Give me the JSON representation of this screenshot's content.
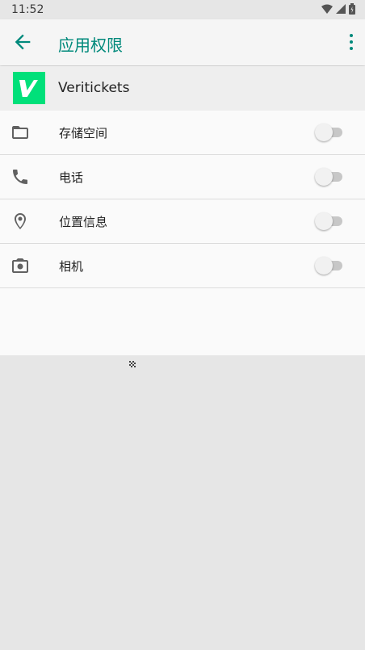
{
  "status_bar": {
    "time": "11:52"
  },
  "app_bar": {
    "title": "应用权限"
  },
  "app": {
    "name": "Veritickets",
    "logo_letter": "V",
    "logo_color": "#00e07a"
  },
  "permissions": [
    {
      "label": "存储空间",
      "icon": "folder-icon",
      "enabled": false
    },
    {
      "label": "电话",
      "icon": "phone-icon",
      "enabled": false
    },
    {
      "label": "位置信息",
      "icon": "location-pin-icon",
      "enabled": false
    },
    {
      "label": "相机",
      "icon": "camera-icon",
      "enabled": false
    }
  ],
  "colors": {
    "accent": "#00897b",
    "toggle_off_track": "#c7c7c7",
    "toggle_off_thumb": "#f1f1f1"
  }
}
